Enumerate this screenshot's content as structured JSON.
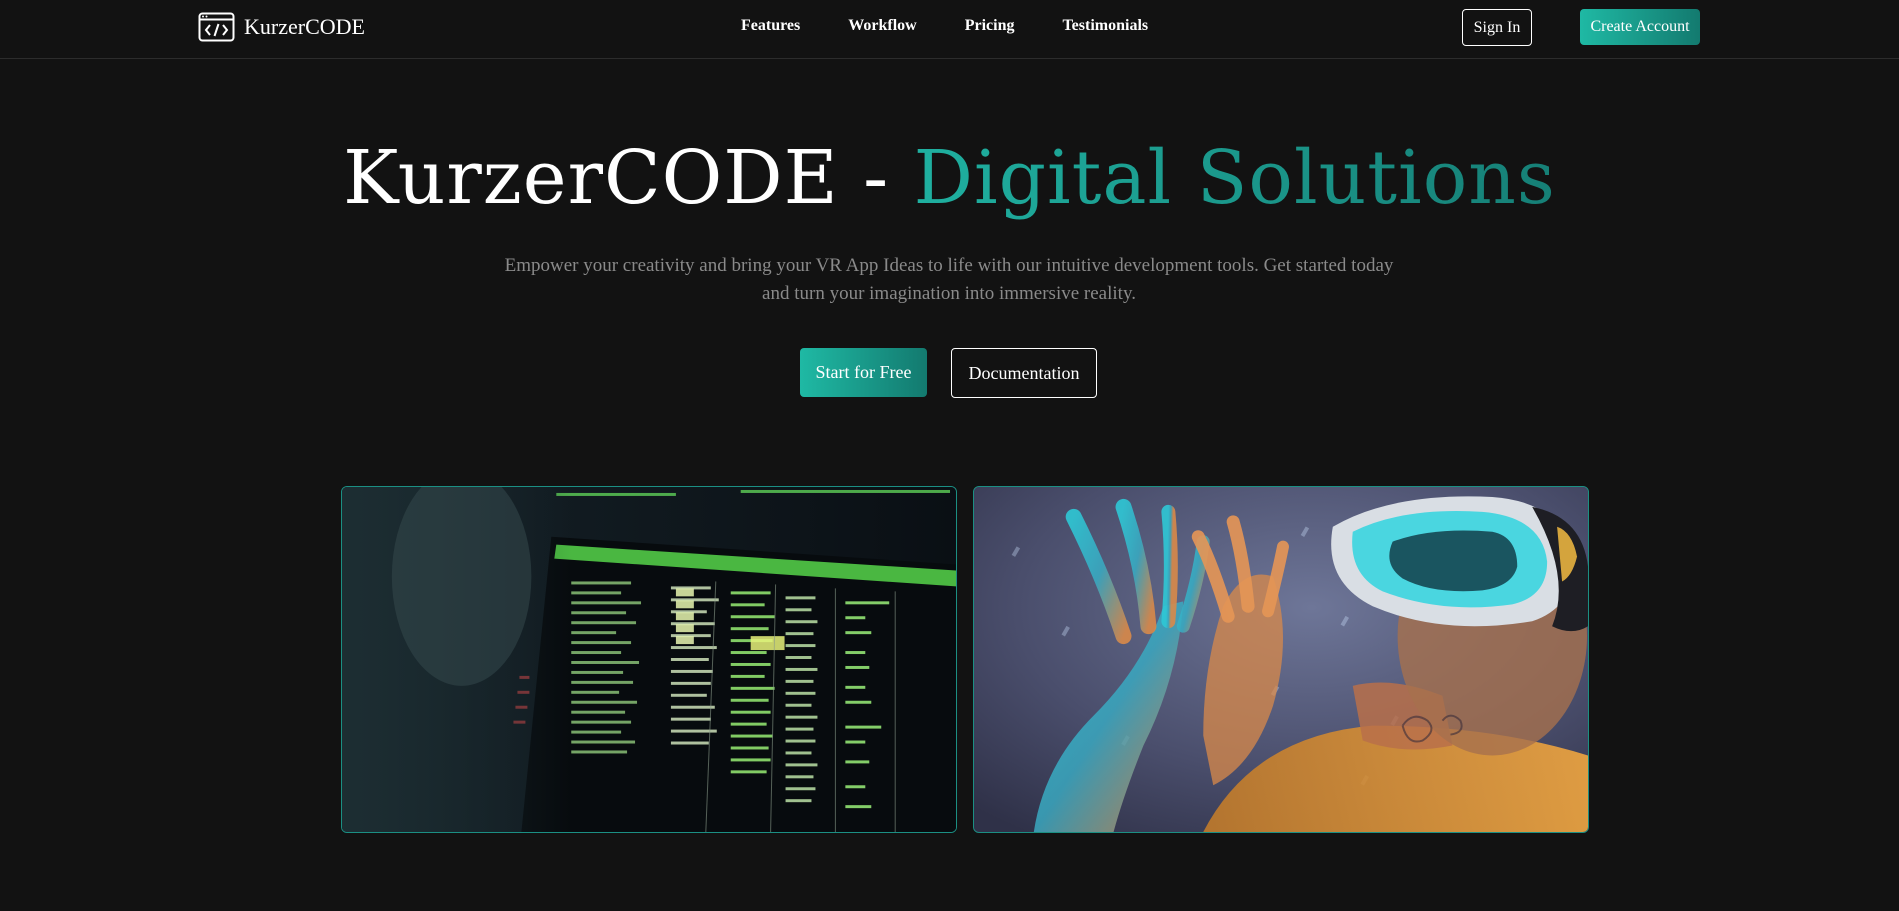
{
  "nav": {
    "brand": "KurzerCODE",
    "links": [
      "Features",
      "Workflow",
      "Pricing",
      "Testimonials"
    ],
    "sign_in": "Sign In",
    "create_account": "Create Account"
  },
  "hero": {
    "title_main": "KurzerCODE - ",
    "title_accent": "Digital Solutions",
    "subtitle": "Empower your creativity and bring your VR App Ideas to life with our intuitive development tools. Get started today and turn your imagination into immersive reality.",
    "primary_cta": "Start for Free",
    "secondary_cta": "Documentation"
  },
  "colors": {
    "background": "#121212",
    "accent_start": "#1fb9a4",
    "accent_end": "#137a6f"
  },
  "icons": {
    "brand": "code-window-icon"
  }
}
